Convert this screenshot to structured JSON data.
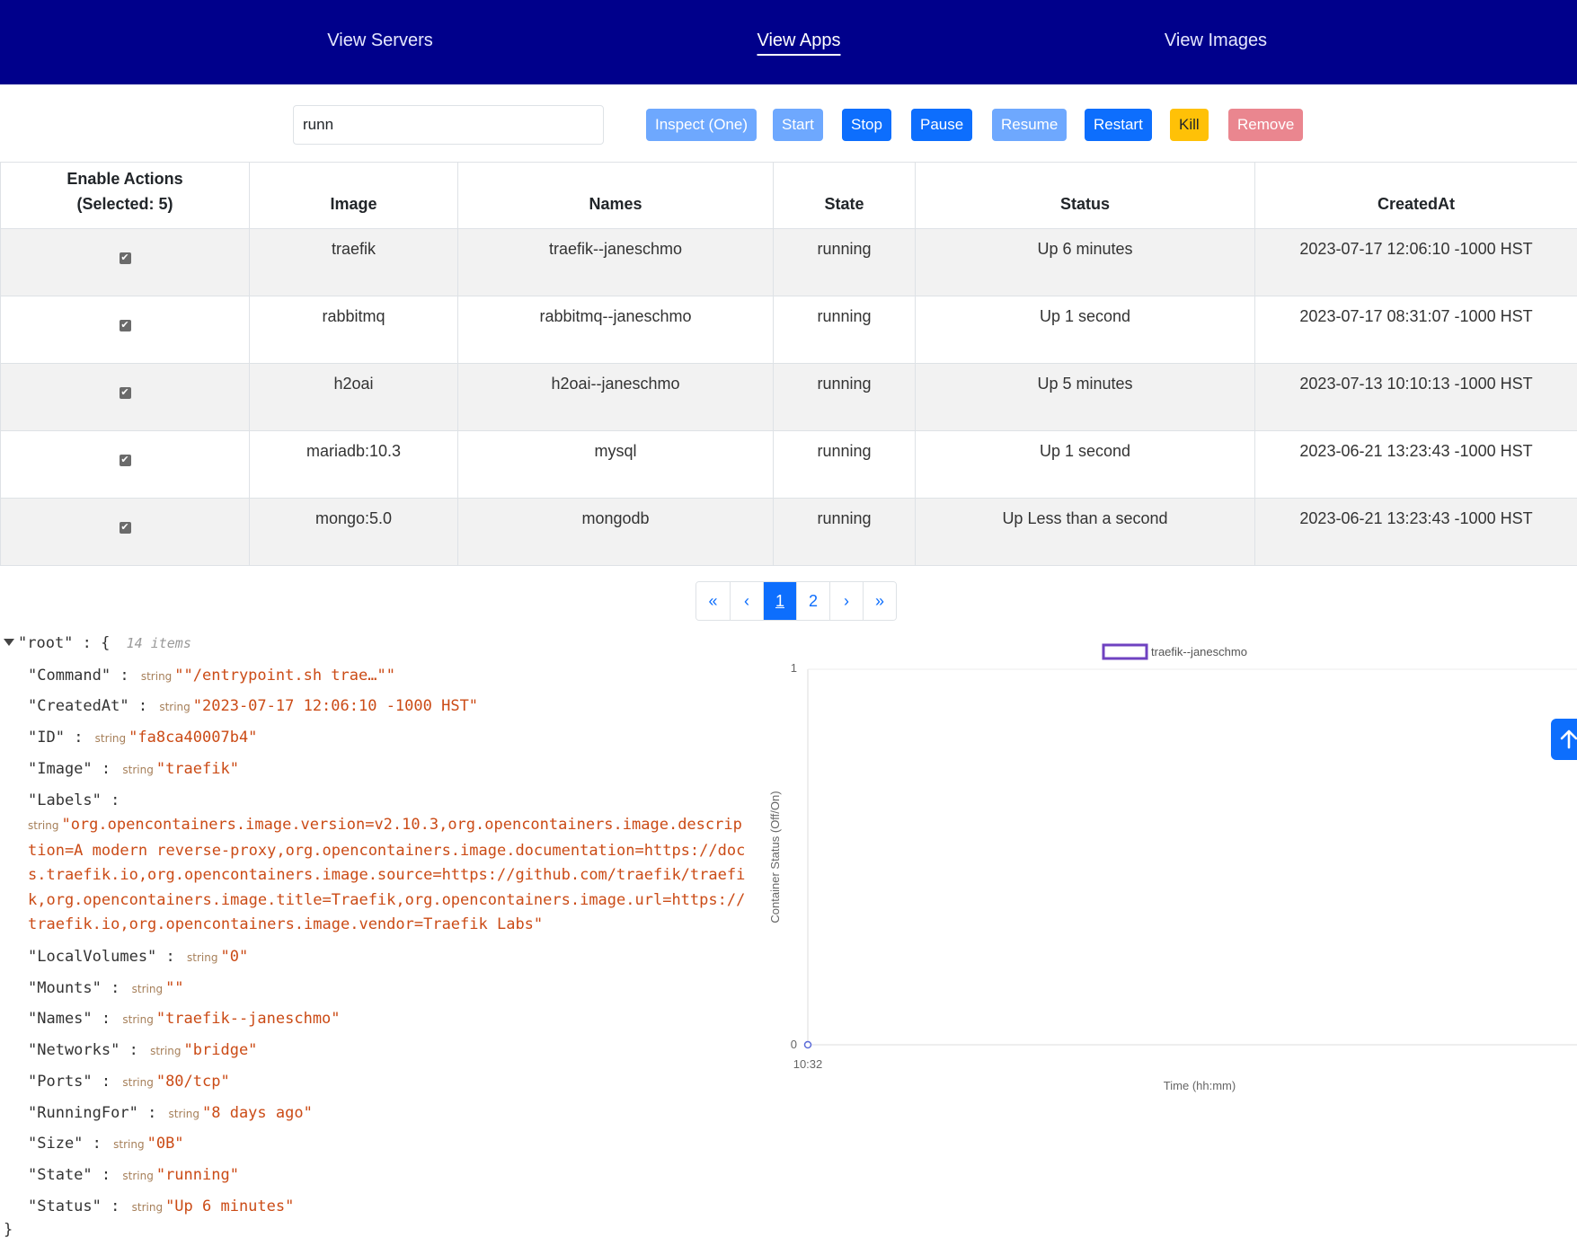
{
  "nav": {
    "items": [
      {
        "label": "View Servers",
        "active": false
      },
      {
        "label": "View Apps",
        "active": true
      },
      {
        "label": "View Images",
        "active": false
      }
    ]
  },
  "search": {
    "value": "runn"
  },
  "actions": {
    "inspect": "Inspect (One)",
    "start": "Start",
    "stop": "Stop",
    "pause": "Pause",
    "resume": "Resume",
    "restart": "Restart",
    "kill": "Kill",
    "remove": "Remove"
  },
  "table": {
    "headers": {
      "enable_line1": "Enable Actions",
      "enable_line2": "(Selected: 5)",
      "image": "Image",
      "names": "Names",
      "state": "State",
      "status": "Status",
      "created": "CreatedAt"
    },
    "rows": [
      {
        "checked": true,
        "image": "traefik",
        "names": "traefik--janeschmo",
        "state": "running",
        "status": "Up 6 minutes",
        "created": "2023-07-17 12:06:10 -1000 HST"
      },
      {
        "checked": true,
        "image": "rabbitmq",
        "names": "rabbitmq--janeschmo",
        "state": "running",
        "status": "Up 1 second",
        "created": "2023-07-17 08:31:07 -1000 HST"
      },
      {
        "checked": true,
        "image": "h2oai",
        "names": "h2oai--janeschmo",
        "state": "running",
        "status": "Up 5 minutes",
        "created": "2023-07-13 10:10:13 -1000 HST"
      },
      {
        "checked": true,
        "image": "mariadb:10.3",
        "names": "mysql",
        "state": "running",
        "status": "Up 1 second",
        "created": "2023-06-21 13:23:43 -1000 HST"
      },
      {
        "checked": true,
        "image": "mongo:5.0",
        "names": "mongodb",
        "state": "running",
        "status": "Up Less than a second",
        "created": "2023-06-21 13:23:43 -1000 HST"
      }
    ]
  },
  "pagination": {
    "first": "«",
    "prev": "‹",
    "pages": [
      "1",
      "2"
    ],
    "current": "1",
    "next": "›",
    "last": "»"
  },
  "json_viewer": {
    "root_label": "\"root\"",
    "item_count": "14 items",
    "type_label": "string",
    "entries": [
      {
        "key": "\"Command\"",
        "value": "\"\"/entrypoint.sh trae…\"\""
      },
      {
        "key": "\"CreatedAt\"",
        "value": "\"2023-07-17 12:06:10 -1000 HST\""
      },
      {
        "key": "\"ID\"",
        "value": "\"fa8ca40007b4\""
      },
      {
        "key": "\"Image\"",
        "value": "\"traefik\""
      },
      {
        "key": "\"Labels\"",
        "value": "\"org.opencontainers.image.version=v2.10.3,org.opencontainers.image.description=A modern reverse-proxy,org.opencontainers.image.documentation=https://docs.traefik.io,org.opencontainers.image.source=https://github.com/traefik/traefik,org.opencontainers.image.title=Traefik,org.opencontainers.image.url=https://traefik.io,org.opencontainers.image.vendor=Traefik Labs\""
      },
      {
        "key": "\"LocalVolumes\"",
        "value": "\"0\""
      },
      {
        "key": "\"Mounts\"",
        "value": "\"\""
      },
      {
        "key": "\"Names\"",
        "value": "\"traefik--janeschmo\""
      },
      {
        "key": "\"Networks\"",
        "value": "\"bridge\""
      },
      {
        "key": "\"Ports\"",
        "value": "\"80/tcp\""
      },
      {
        "key": "\"RunningFor\"",
        "value": "\"8 days ago\""
      },
      {
        "key": "\"Size\"",
        "value": "\"0B\""
      },
      {
        "key": "\"State\"",
        "value": "\"running\""
      },
      {
        "key": "\"Status\"",
        "value": "\"Up 6 minutes\""
      }
    ]
  },
  "chart_data": {
    "type": "line",
    "title": "",
    "xlabel": "Time (hh:mm)",
    "ylabel": "Container Status (Off/On)",
    "ylim": [
      0,
      1
    ],
    "y_ticks": [
      "0",
      "1"
    ],
    "x_ticks": [
      "10:32"
    ],
    "legend_position": "top",
    "series": [
      {
        "name": "traefik--janeschmo",
        "color": "#6f42c1",
        "x": [
          "10:32"
        ],
        "y": [
          0
        ]
      }
    ]
  },
  "scroll_top": {
    "icon": "arrow-up-icon"
  }
}
